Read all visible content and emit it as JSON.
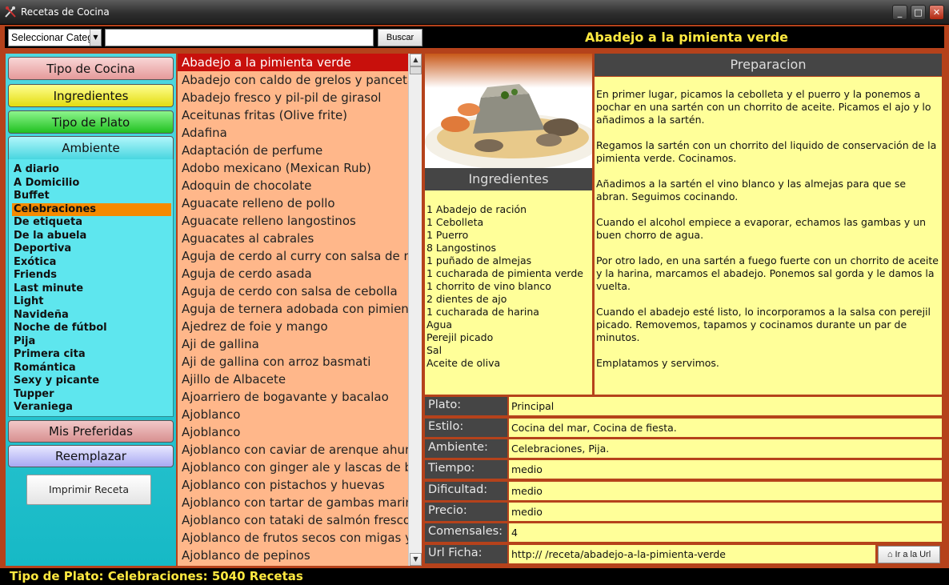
{
  "window": {
    "title": "Recetas de Cocina",
    "minimize": "_",
    "maximize": "□",
    "close": "✕"
  },
  "toolbar": {
    "category_select": "Seleccionar Categoría",
    "search_value": "",
    "search_button": "Buscar",
    "recipe_title": "Abadejo a la pimienta verde"
  },
  "categories": {
    "tipo_cocina": "Tipo de Cocina",
    "ingredientes": "Ingredientes",
    "tipo_plato": "Tipo de Plato",
    "ambiente": "Ambiente",
    "mis_preferidas": "Mis Preferidas",
    "reemplazar": "Reemplazar",
    "print": "Imprimir Receta"
  },
  "ambiente_items": [
    "A diario",
    "A Domicilio",
    "Buffet",
    "Celebraciones",
    "De etiqueta",
    "De la abuela",
    "Deportiva",
    "Exótica",
    "Friends",
    "Last minute",
    "Light",
    "Navideña",
    "Noche de fútbol",
    "Pija",
    "Primera cita",
    "Romántica",
    "Sexy y picante",
    "Tupper",
    "Veraniega"
  ],
  "ambiente_selected": "Celebraciones",
  "recipes": [
    "Abadejo a la pimienta verde",
    "Abadejo con caldo de grelos y panceta",
    "Abadejo fresco y pil-pil de girasol",
    "Aceitunas fritas (Olive frite)",
    "Adafina",
    "Adaptación de perfume",
    "Adobo mexicano (Mexican Rub)",
    "Adoquin de chocolate",
    "Aguacate relleno de pollo",
    "Aguacate relleno langostinos",
    "Aguacates al cabrales",
    "Aguja de cerdo al curry con salsa de mango",
    "Aguja de cerdo asada",
    "Aguja de cerdo con salsa de cebolla",
    "Aguja de ternera adobada con pimientos",
    "Ajedrez de foie y mango",
    "Aji de gallina",
    "Aji de gallina con arroz basmati",
    "Ajillo de Albacete",
    "Ajoarriero de bogavante y bacalao",
    "Ajoblanco",
    "Ajoblanco",
    "Ajoblanco con caviar de arenque ahumado",
    "Ajoblanco con ginger ale y lascas de bacalao",
    "Ajoblanco con pistachos y huevas",
    "Ajoblanco con tartar de gambas marinadas",
    "Ajoblanco con tataki de salmón fresco",
    "Ajoblanco de frutos secos con migas y uvas",
    "Ajoblanco de pepinos"
  ],
  "selected_recipe": "Abadejo a la pimienta verde",
  "ingredients_title": "Ingredientes",
  "ingredients": [
    "1 Abadejo de ración",
    "1 Cebolleta",
    "1 Puerro",
    "8 Langostinos",
    "1 puñado de almejas",
    "1 cucharada de pimienta verde",
    "1 chorrito de vino blanco",
    "2 dientes de ajo",
    "1 cucharada de harina",
    "Agua",
    "Perejil picado",
    "Sal",
    "Aceite de oliva"
  ],
  "preparation_title": "Preparacion",
  "preparation": [
    "En primer lugar, picamos la cebolleta y el puerro y la ponemos a pochar en una sartén con un chorrito de aceite. Picamos el ajo y lo añadimos a la sartén.",
    "Regamos la sartén con un chorrito del liquido de conservación de la pimienta verde. Cocinamos.",
    "Añadimos a la sartén el vino blanco y las almejas para que se abran. Seguimos cocinando.",
    "Cuando el alcohol empiece a evaporar, echamos las gambas y un buen chorro de agua.",
    "Por otro lado, en una sartén a fuego fuerte con un chorrito de aceite y la harina, marcamos el abadejo. Ponemos sal gorda y le damos la vuelta.",
    "Cuando el abadejo esté listo, lo incorporamos a la salsa con perejil picado. Removemos, tapamos y cocinamos durante un par de minutos.",
    "Emplatamos y servimos."
  ],
  "info": [
    {
      "label": "Plato:",
      "value": "Principal"
    },
    {
      "label": "Estilo:",
      "value": "Cocina del mar, Cocina de fiesta."
    },
    {
      "label": "Ambiente:",
      "value": "Celebraciones, Pija."
    },
    {
      "label": "Tiempo:",
      "value": "medio"
    },
    {
      "label": "Dificultad:",
      "value": "medio"
    },
    {
      "label": "Precio:",
      "value": "medio"
    },
    {
      "label": "Comensales:",
      "value": "4"
    },
    {
      "label": "Url Ficha:",
      "value": "http://                    /receta/abadejo-a-la-pimienta-verde"
    }
  ],
  "url_button": "Ir a la Url",
  "status": "Tipo de Plato: Celebraciones: 5040 Recetas",
  "colors": {
    "frame": "#b5421b",
    "list_bg": "#ffb78a",
    "selected": "#c8100c",
    "panel_yellow": "#ffff99",
    "title_yellow": "#ffe940",
    "ambiente_sel": "#f58a00"
  }
}
